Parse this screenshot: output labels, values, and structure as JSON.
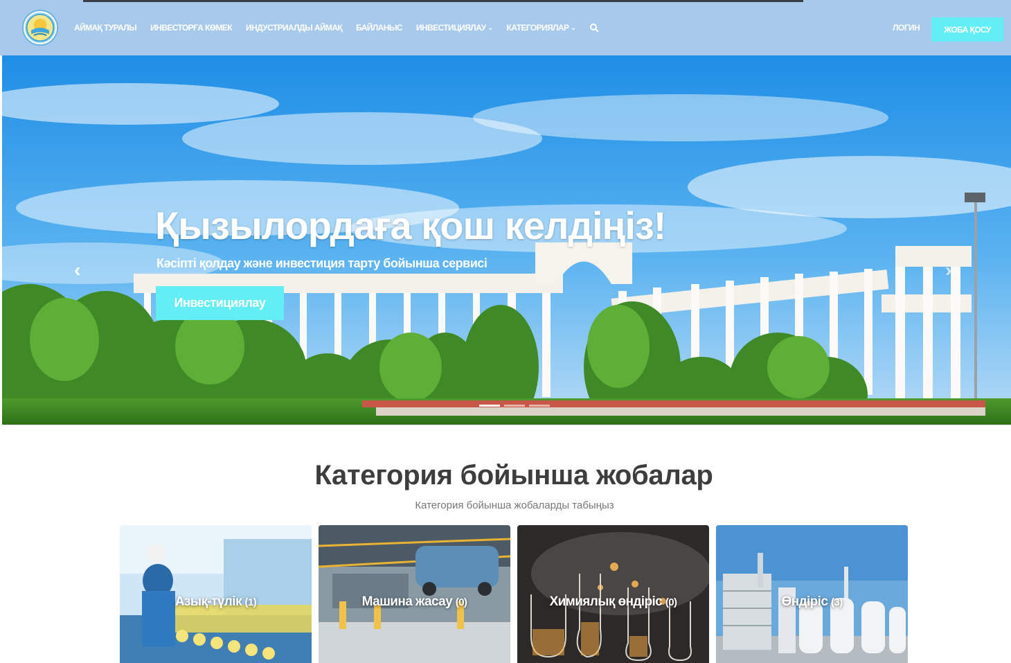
{
  "nav": {
    "items": [
      {
        "label": "АЙМАҚ ТУРАЛЫ"
      },
      {
        "label": "ИНВЕСТОРҒА КӨМЕК"
      },
      {
        "label": "ИНДУСТРИАЛДЫ АЙМАҚ"
      },
      {
        "label": "БАЙЛАНЫС"
      },
      {
        "label": "ИНВЕСТИЦИЯЛАУ"
      },
      {
        "label": "КАТЕГОРИЯЛАР"
      }
    ],
    "login": "ЛОГИН",
    "add_project": "ЖОБА ҚОСУ"
  },
  "hero": {
    "title": "Қызылордаға қош келдіңіз!",
    "subtitle": "Кәсіпті қолдау және инвестиция тарту бойынша сервисі",
    "button": "Инвестициялау",
    "slides_count": 3,
    "active_slide": 0
  },
  "categories_section": {
    "title": "Категория бойынша жобалар",
    "subtitle": "Категория бойынша жобаларды табыңыз",
    "cards": [
      {
        "name": "Азық-түлік",
        "count": "(1)"
      },
      {
        "name": "Машина жасау",
        "count": "(0)"
      },
      {
        "name": "Химиялық өндіріс",
        "count": "(0)"
      },
      {
        "name": "Өндіріс",
        "count": "(3)"
      }
    ]
  },
  "colors": {
    "navbar_bg": "#a7c9ec",
    "accent": "#63eef5",
    "heading": "#3d3d3d",
    "muted": "#777777"
  },
  "icons": [
    "emblem-logo",
    "chevron-down-icon",
    "search-icon",
    "chevron-left-icon",
    "chevron-right-icon"
  ]
}
